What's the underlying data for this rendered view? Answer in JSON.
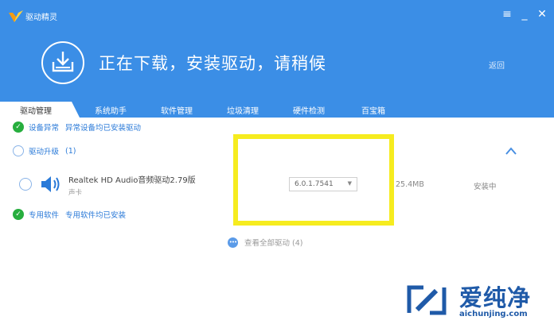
{
  "app": {
    "title": "驱动精灵"
  },
  "window_controls": {
    "menu": "≡",
    "minimize": "_",
    "close": "✕"
  },
  "header": {
    "status_title": "正在下载，安装驱动，请稍候",
    "back_label": "返回"
  },
  "tabs": [
    {
      "label": "驱动管理",
      "active": true
    },
    {
      "label": "系统助手",
      "active": false
    },
    {
      "label": "软件管理",
      "active": false
    },
    {
      "label": "垃圾清理",
      "active": false
    },
    {
      "label": "硬件检测",
      "active": false
    },
    {
      "label": "百宝箱",
      "active": false
    }
  ],
  "sections": {
    "device_error": {
      "title": "设备异常",
      "message": "异常设备均已安装驱动"
    },
    "driver_upgrade": {
      "title": "驱动升级",
      "count": "(1)"
    },
    "dedicated_software": {
      "title": "专用软件",
      "message": "专用软件均已安装"
    }
  },
  "driver": {
    "name": "Realtek HD Audio音频驱动2.79版",
    "type": "声卡",
    "version": "6.0.1.7541",
    "size": "25.4MB",
    "status": "安装中"
  },
  "view_all": {
    "label": "查看全部驱动 (4)"
  },
  "watermark": {
    "name": "爱纯净",
    "url": "aichunjing.com"
  },
  "colors": {
    "header_blue": "#3b8ee6",
    "success_green": "#27ae3e",
    "highlight_yellow": "#f6ec1f",
    "watermark_blue": "#1f5aa8"
  }
}
